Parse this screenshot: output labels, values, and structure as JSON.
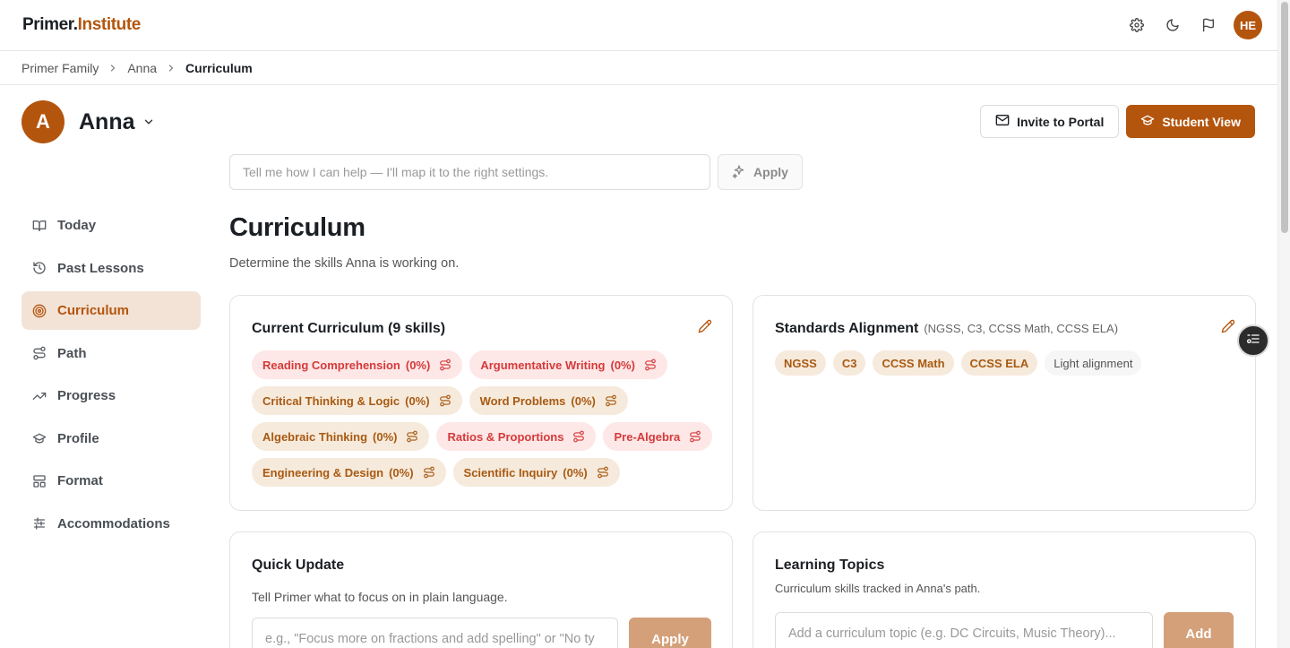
{
  "app": {
    "logo_part1": "Primer.",
    "logo_part2": "Institute"
  },
  "topbar": {
    "avatar_initials": "HE",
    "icons": [
      "gear-icon",
      "moon-icon",
      "flag-icon"
    ]
  },
  "breadcrumb": {
    "items": [
      "Primer Family",
      "Anna"
    ],
    "current": "Curriculum"
  },
  "student": {
    "initial": "A",
    "name": "Anna"
  },
  "header_buttons": {
    "invite": "Invite to Portal",
    "student_view": "Student View"
  },
  "assistant": {
    "placeholder": "Tell me how I can help — I'll map it to the right settings.",
    "apply": "Apply"
  },
  "sidebar": {
    "items": [
      {
        "label": "Today",
        "icon": "book-open-icon"
      },
      {
        "label": "Past Lessons",
        "icon": "history-icon"
      },
      {
        "label": "Curriculum",
        "icon": "target-icon",
        "active": true
      },
      {
        "label": "Path",
        "icon": "route-icon"
      },
      {
        "label": "Progress",
        "icon": "trending-up-icon"
      },
      {
        "label": "Profile",
        "icon": "graduation-cap-icon"
      },
      {
        "label": "Format",
        "icon": "layout-icon"
      },
      {
        "label": "Accommodations",
        "icon": "sliders-icon"
      }
    ]
  },
  "page": {
    "title": "Curriculum",
    "subtitle": "Determine the skills Anna is working on."
  },
  "current_curriculum": {
    "title": "Current Curriculum (9 skills)",
    "skills": [
      {
        "name": "Reading Comprehension",
        "pct": "(0%)",
        "tone": "red"
      },
      {
        "name": "Argumentative Writing",
        "pct": "(0%)",
        "tone": "red"
      },
      {
        "name": "Critical Thinking & Logic",
        "pct": "(0%)",
        "tone": "amber"
      },
      {
        "name": "Word Problems",
        "pct": "(0%)",
        "tone": "amber"
      },
      {
        "name": "Algebraic Thinking",
        "pct": "(0%)",
        "tone": "amber"
      },
      {
        "name": "Ratios & Proportions",
        "pct": "(0%)",
        "tone": "red"
      },
      {
        "name": "Pre-Algebra",
        "pct": "",
        "tone": "red"
      },
      {
        "name": "Engineering & Design",
        "pct": "(0%)",
        "tone": "amber"
      },
      {
        "name": "Scientific Inquiry",
        "pct": "(0%)",
        "tone": "amber"
      }
    ]
  },
  "standards": {
    "title": "Standards Alignment",
    "subtitle": "(NGSS, C3, CCSS Math, CCSS ELA)",
    "chips": [
      "NGSS",
      "C3",
      "CCSS Math",
      "CCSS ELA"
    ],
    "level": "Light alignment"
  },
  "quick_update": {
    "title": "Quick Update",
    "description": "Tell Primer what to focus on in plain language.",
    "placeholder": "e.g., \"Focus more on fractions and add spelling\" or \"No ty",
    "apply": "Apply"
  },
  "learning_topics": {
    "title": "Learning Topics",
    "description": "Curriculum skills tracked in Anna's path.",
    "placeholder": "Add a curriculum topic (e.g. DC Circuits, Music Theory)...",
    "add": "Add"
  },
  "colors": {
    "accent": "#b4550e",
    "accent_light": "#f2e3d6",
    "danger": "#d63a3a",
    "danger_bg": "#fde7e7"
  }
}
